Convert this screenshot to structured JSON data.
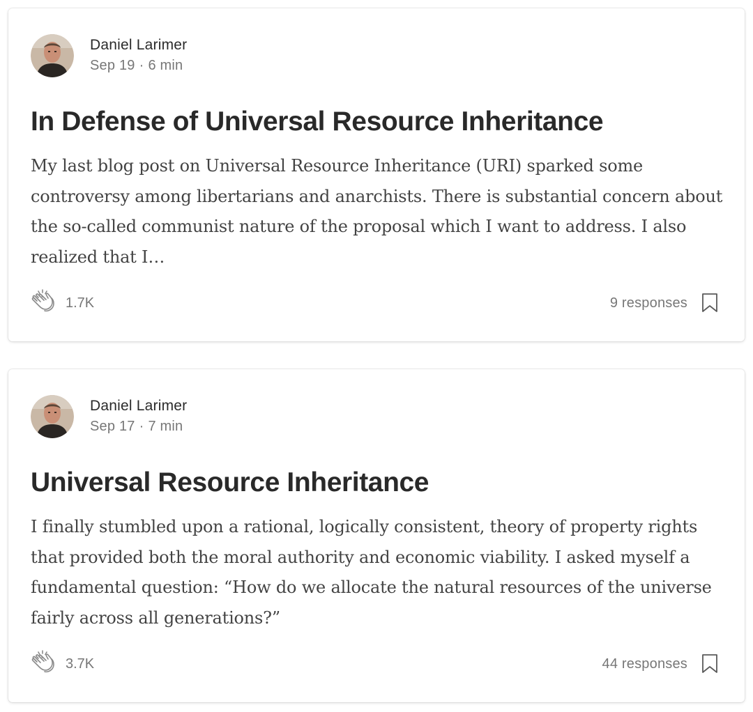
{
  "posts": [
    {
      "author": "Daniel Larimer",
      "date": "Sep 19",
      "separator": "·",
      "read_time": "6 min",
      "title": "In Defense of Universal Resource Inheritance",
      "excerpt_lines": [
        "My last blog post on Universal Resource Inheritance (URI) sparked some",
        "controversy among libertarians and anarchists. There is substantial concern about",
        "the so-called communist nature of the proposal which I want to address. I also",
        "realized that I…"
      ],
      "claps": "1.7K",
      "responses": "9 responses",
      "icons": {
        "clap": "clap-icon",
        "bookmark": "bookmark-icon"
      }
    },
    {
      "author": "Daniel Larimer",
      "date": "Sep 17",
      "separator": "·",
      "read_time": "7 min",
      "title": "Universal Resource Inheritance",
      "excerpt_lines": [
        "I finally stumbled upon a rational, logically consistent, theory of property rights",
        "that provided both the moral authority and economic viability. I asked myself a",
        "fundamental question: “How do we allocate the natural resources of the universe",
        "fairly across all generations?”"
      ],
      "claps": "3.7K",
      "responses": "44 responses",
      "icons": {
        "clap": "clap-icon",
        "bookmark": "bookmark-icon"
      }
    }
  ],
  "colors": {
    "text_primary": "#2b2b2b",
    "text_secondary": "#757575",
    "icon_gray": "#8a8a8a",
    "card_background": "#ffffff"
  }
}
